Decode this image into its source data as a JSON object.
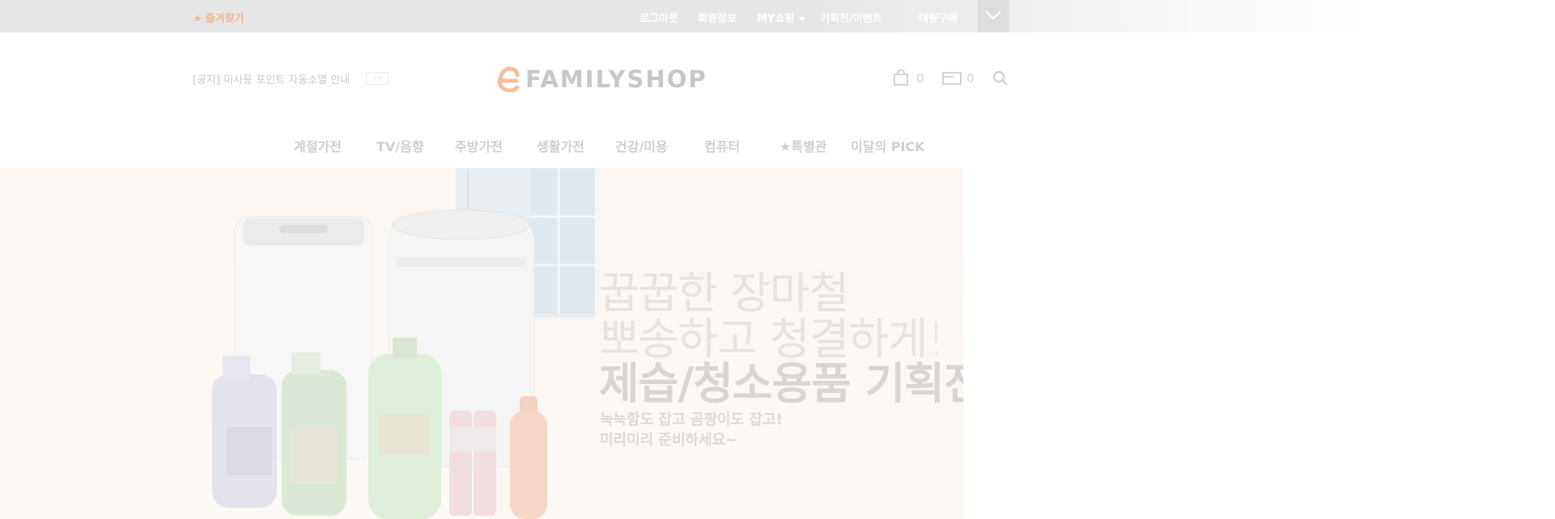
{
  "topbar": {
    "favorite": "즐겨찾기",
    "links": [
      "로그아웃",
      "회원정보",
      "MY쇼핑",
      "기획전/이벤트",
      "대량구매"
    ]
  },
  "header": {
    "notice": "[공지] 미사용 포인트 자동소멸 안내",
    "logo_text": "FAMILYSHOP",
    "cart_count": "0",
    "coupon_count": "0"
  },
  "gnb": {
    "items": [
      "계절가전",
      "TV/음향",
      "주방가전",
      "생활가전",
      "건강/미용",
      "컴퓨터",
      "★특별관",
      "이달의 PICK"
    ]
  },
  "banner": {
    "line1": "꿉꿉한 장마철",
    "line2": "뽀송하고 청결하게!",
    "line3": "제습/청소용품 기획전",
    "sub1": "눅눅함도 잡고 곰팡이도 잡고!",
    "sub2": "미리미리 준비하세요~"
  },
  "colors": {
    "accent": "#f3b48e",
    "banner_bg": "#fbf6f1"
  }
}
